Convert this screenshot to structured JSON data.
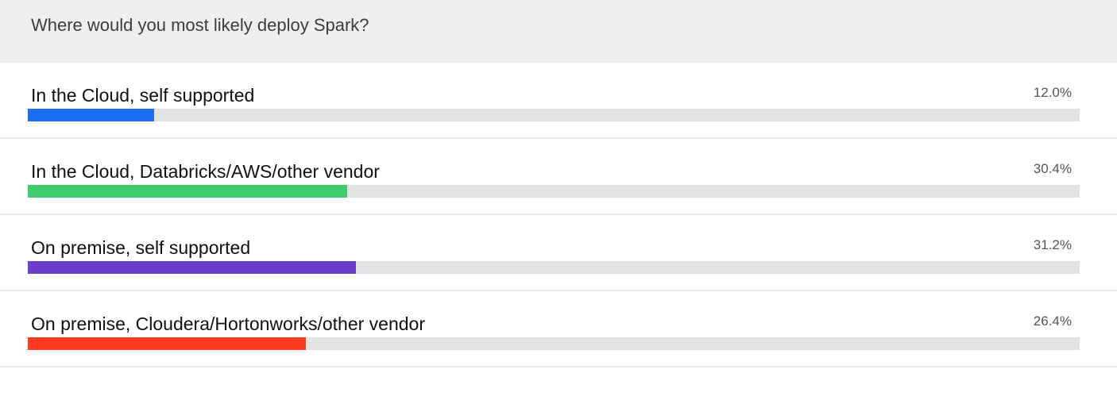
{
  "poll": {
    "question": "Where would you most likely deploy Spark?"
  },
  "chart_data": {
    "type": "bar",
    "title": "Where would you most likely deploy Spark?",
    "categories": [
      "In the Cloud, self supported",
      "In the Cloud, Databricks/AWS/other vendor",
      "On premise, self supported",
      "On premise, Cloudera/Hortonworks/other vendor"
    ],
    "values": [
      12.0,
      30.4,
      31.2,
      26.4
    ],
    "value_labels": [
      "12.0%",
      "30.4%",
      "31.2%",
      "26.4%"
    ],
    "colors": [
      "#1a6ef5",
      "#3fcc6c",
      "#6a3ec8",
      "#ff3a24"
    ],
    "ylim": [
      0,
      100
    ],
    "unit": "%"
  }
}
